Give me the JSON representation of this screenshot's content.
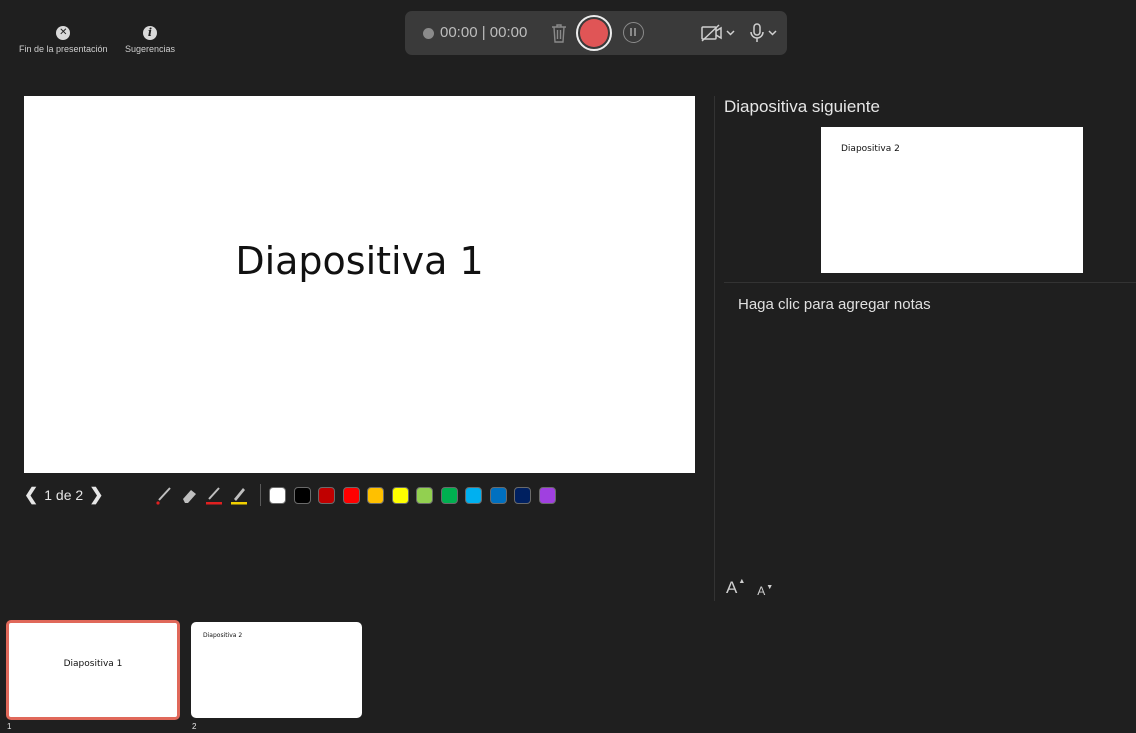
{
  "top_controls": {
    "end_label": "Fin de la presentación",
    "hints_label": "Sugerencias"
  },
  "recorder": {
    "time": "00:00 | 00:00",
    "record_color": "#e05556"
  },
  "slide": {
    "current_title": "Diapositiva 1"
  },
  "navigation": {
    "prev_icon": "chevron-left-icon",
    "counter": "1 de 2",
    "next_icon": "chevron-right-icon"
  },
  "ink_tools": [
    {
      "name": "laser-pointer-icon"
    },
    {
      "name": "eraser-icon"
    },
    {
      "name": "pen-icon",
      "color": "#e02020"
    },
    {
      "name": "highlighter-icon",
      "color": "#f2d000"
    }
  ],
  "colors": [
    "#ffffff",
    "#000000",
    "#c00000",
    "#ff0000",
    "#ffc000",
    "#ffff00",
    "#92d050",
    "#00b050",
    "#00b0f0",
    "#0070c0",
    "#002060",
    "#a040e0"
  ],
  "right_panel": {
    "next_label": "Diapositiva siguiente",
    "next_slide_title": "Diapositiva 2",
    "notes_placeholder": "Haga clic para agregar notas",
    "font_increase": "A",
    "font_decrease": "A"
  },
  "thumbnails": [
    {
      "number": "1",
      "title": "Diapositiva 1",
      "selected": true
    },
    {
      "number": "2",
      "title": "Diapositiva 2",
      "selected": false
    }
  ]
}
